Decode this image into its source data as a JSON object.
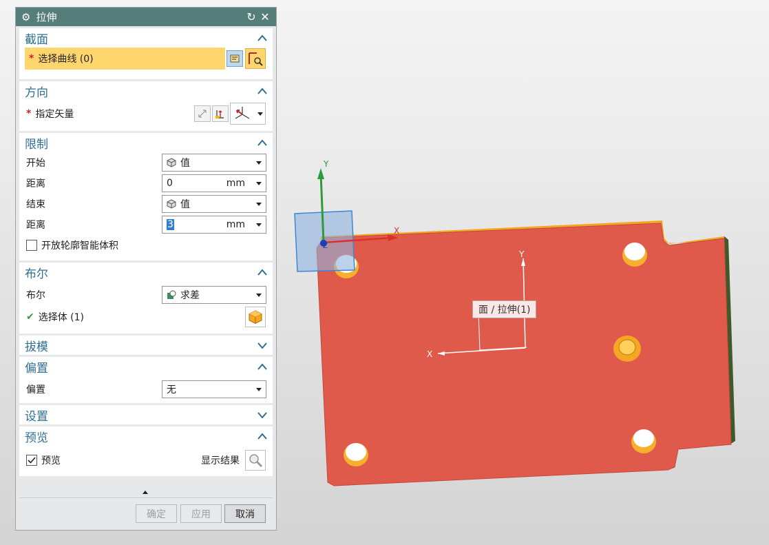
{
  "dialog": {
    "title": "拉伸",
    "reset_icon": "reset-icon",
    "close_icon": "close-icon"
  },
  "section": {
    "title": "截面",
    "select_curve_label": "选择曲线 (0)",
    "required_mark": "*"
  },
  "direction": {
    "title": "方向",
    "specify_vector_label": "指定矢量",
    "required_mark": "*"
  },
  "limits": {
    "title": "限制",
    "start_label": "开始",
    "start_value": "值",
    "start_distance_label": "距离",
    "start_distance_value": "0",
    "start_distance_unit": "mm",
    "end_label": "结束",
    "end_value": "值",
    "end_distance_label": "距离",
    "end_distance_value": "3",
    "end_distance_unit": "mm",
    "open_profile_label": "开放轮廓智能体积"
  },
  "boolean": {
    "title": "布尔",
    "boolean_label": "布尔",
    "boolean_value": "求差",
    "select_body_label": "选择体 (1)"
  },
  "draft": {
    "title": "拔模"
  },
  "offset": {
    "title": "偏置",
    "offset_label": "偏置",
    "offset_value": "无"
  },
  "settings": {
    "title": "设置"
  },
  "preview": {
    "title": "预览",
    "preview_label": "预览",
    "preview_checked": true,
    "show_result_label": "显示结果"
  },
  "buttons": {
    "ok": "确定",
    "apply": "应用",
    "cancel": "取消"
  },
  "viewport": {
    "tooltip": "面 / 拉伸(1)",
    "axis_y": "Y",
    "axis_x": "X",
    "axis_z": "Z",
    "face_color": "#e05a4b",
    "edge_color": "#f5a623"
  }
}
